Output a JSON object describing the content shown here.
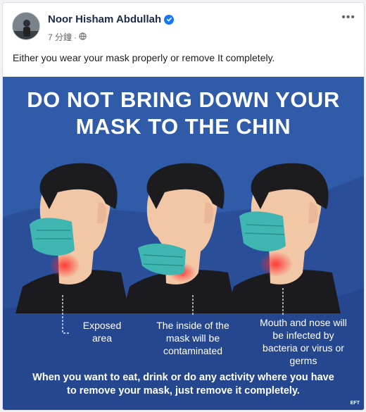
{
  "post": {
    "author": "Noor Hisham Abdullah",
    "time": "7 分鐘",
    "separator": "·",
    "caption": "Either you wear your mask properly or remove It completely.",
    "more_label": "•••"
  },
  "poster": {
    "headline_line1": "DO NOT BRING DOWN YOUR",
    "headline_line2": "MASK TO THE CHIN",
    "labels": [
      {
        "line1": "Exposed",
        "line2": "area",
        "line3": "",
        "line4": ""
      },
      {
        "line1": "The inside of the",
        "line2": "mask will be",
        "line3": "contaminated",
        "line4": ""
      },
      {
        "line1": "Mouth and nose will",
        "line2": "be infected by",
        "line3": "bacteria or virus or",
        "line4": "germs"
      }
    ],
    "bottom_line1": "When you want to eat, drink or do any activity where you have",
    "bottom_line2": "to remove your mask, just remove it completely.",
    "watermark": "EFT"
  },
  "colors": {
    "poster_bg": "#2e5aa8",
    "mask": "#3fb6b2",
    "shirt": "#1b1b1f",
    "skin": "#f2c7a6",
    "glow": "#ff2a2a",
    "verified": "#1877f2"
  },
  "icons": {
    "verified": "verified-badge-icon",
    "privacy": "globe-icon",
    "menu": "more-options-icon"
  }
}
